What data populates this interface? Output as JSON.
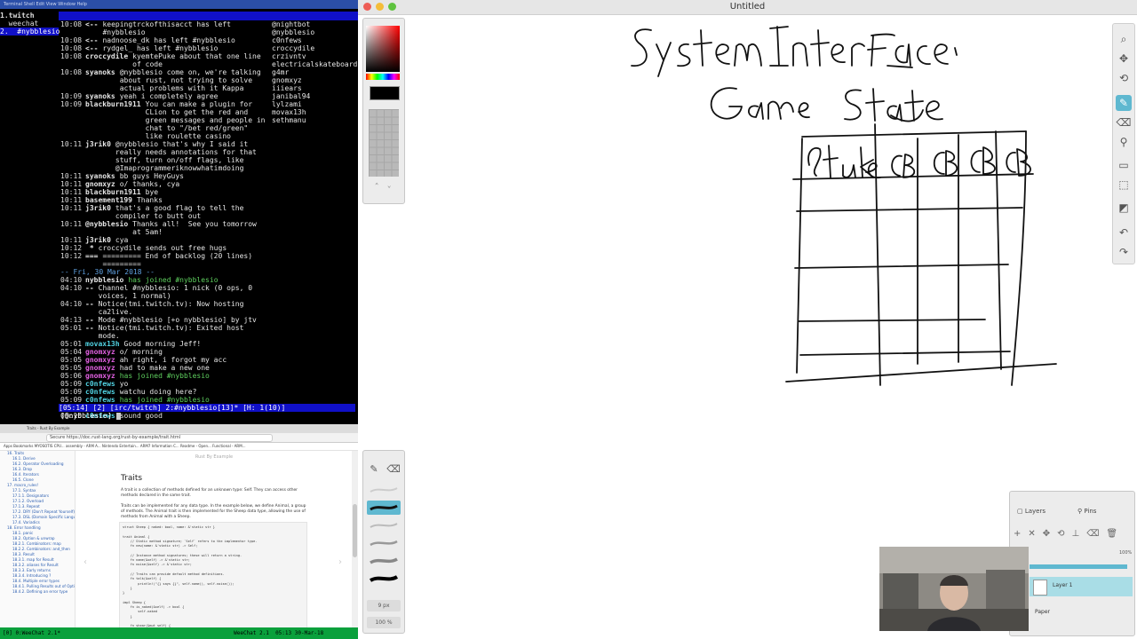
{
  "terminal": {
    "menubar": "Terminal  Shell  Edit  View  Window  Help",
    "buflist": [
      {
        "label": "1.twitch",
        "selected": false,
        "bold": true
      },
      {
        "label": "  weechat",
        "selected": false
      },
      {
        "label": "2.  #nybblesio",
        "selected": true
      }
    ],
    "lines": [
      {
        "time": "10:08",
        "nick": "<--",
        "msg": "keepingtrckofthisacct has left #nybblesio",
        "kind": "part"
      },
      {
        "time": "10:08",
        "nick": "<--",
        "msg": "nadnoose_dk has left #nybblesio",
        "kind": "part"
      },
      {
        "time": "10:08",
        "nick": "<--",
        "msg": "rydgel_ has left #nybblesio",
        "kind": "part"
      },
      {
        "time": "10:08",
        "nick": "croccydile",
        "msg": "kyemtePuke about that one line of code",
        "kind": "msg"
      },
      {
        "time": "10:08",
        "nick": "syanoks",
        "msg": "@nybblesio come on, we're talking about rust, not trying to solve actual problems with it Kappa",
        "kind": "msg"
      },
      {
        "time": "10:09",
        "nick": "syanoks",
        "msg": "yeah i completely agree",
        "kind": "msg"
      },
      {
        "time": "10:09",
        "nick": "blackburn1911",
        "msg": "You can make a plugin for CLion to get the red and green messages and people in chat to \"/bet red/green\" like roulette casino",
        "kind": "msg"
      },
      {
        "time": "10:11",
        "nick": "j3rik0",
        "msg": "@nybblesio that's why I said it really needs annotations for that stuff, turn on/off flags, like @Imaprogrammeriknowwhatimdoing",
        "kind": "msg"
      },
      {
        "time": "10:11",
        "nick": "syanoks",
        "msg": "bb guys HeyGuys",
        "kind": "msg"
      },
      {
        "time": "10:11",
        "nick": "gnomxyz",
        "msg": "o/ thanks, cya",
        "kind": "msg"
      },
      {
        "time": "10:11",
        "nick": "blackburn1911",
        "msg": "bye",
        "kind": "msg"
      },
      {
        "time": "10:11",
        "nick": "basement199",
        "msg": "Thanks",
        "kind": "msg"
      },
      {
        "time": "10:11",
        "nick": "j3rik0",
        "msg": "that's a good flag to tell the compiler to butt out",
        "kind": "msg"
      },
      {
        "time": "10:11",
        "nick": "@nybblesio",
        "msg": "Thanks all!  See you tomorrow at 5am!",
        "kind": "msg"
      },
      {
        "time": "10:11",
        "nick": "j3rik0",
        "msg": "cya",
        "kind": "msg"
      },
      {
        "time": "10:12",
        "nick": " *",
        "msg": "croccydile sends out free hugs",
        "kind": "msg"
      },
      {
        "time": "10:12",
        "nick": "===",
        "msg": "========= End of backlog (20 lines) =========",
        "kind": "msg"
      },
      {
        "time": "",
        "nick": "",
        "msg": "-- Fri, 30 Mar 2018 --",
        "kind": "date"
      },
      {
        "time": "04:10",
        "nick": "nybblesio",
        "msg": "has joined #nybblesio",
        "kind": "join"
      },
      {
        "time": "04:10",
        "nick": "--",
        "msg": "Channel #nybblesio: 1 nick (0 ops, 0 voices, 1 normal)",
        "kind": "msg"
      },
      {
        "time": "04:10",
        "nick": "--",
        "msg": "Notice(tmi.twitch.tv): Now hosting ca2live.",
        "kind": "msg"
      },
      {
        "time": "04:13",
        "nick": "--",
        "msg": "Mode #nybblesio [+o nybblesio] by jtv",
        "kind": "msg"
      },
      {
        "time": "05:01",
        "nick": "--",
        "msg": "Notice(tmi.twitch.tv): Exited host mode.",
        "kind": "msg"
      },
      {
        "time": "05:01",
        "nick": "movax13h",
        "msg": "Good morning Jeff!",
        "kind": "msg",
        "color": "cyan"
      },
      {
        "time": "05:04",
        "nick": "gnomxyz",
        "msg": "o/ morning",
        "kind": "msg",
        "color": "magenta"
      },
      {
        "time": "05:05",
        "nick": "gnomxyz",
        "msg": "ah right, i forgot my acc",
        "kind": "msg",
        "color": "magenta"
      },
      {
        "time": "05:05",
        "nick": "gnomxyz",
        "msg": "had to make a new one",
        "kind": "msg",
        "color": "magenta"
      },
      {
        "time": "05:06",
        "nick": "gnomxyz",
        "msg": "has joined #nybblesio",
        "kind": "join",
        "color": "magenta"
      },
      {
        "time": "05:09",
        "nick": "c0nfews",
        "msg": "yo",
        "kind": "msg",
        "color": "cyan"
      },
      {
        "time": "05:09",
        "nick": "c0nfews",
        "msg": "watchu doing here?",
        "kind": "msg",
        "color": "cyan"
      },
      {
        "time": "05:09",
        "nick": "c0nfews",
        "msg": "has joined #nybblesio",
        "kind": "join",
        "color": "cyan"
      },
      {
        "time": "05:10",
        "nick": "c0nfews",
        "msg": "i don't know what that means but",
        "kind": "msg",
        "color": "cyan"
      },
      {
        "time": "05:10",
        "nick": "c0nfews",
        "msg": "sound good",
        "kind": "msg",
        "color": "cyan"
      }
    ],
    "nicklist": [
      "@nightbot",
      "@nybblesio",
      "c0nfews",
      "croccydile",
      "crzivntv",
      "electricalskateboard",
      "g4mr",
      "gnomxyz",
      "iiiears",
      "janibal94",
      "lylzami",
      "movax13h",
      "sethmanu"
    ],
    "statusbar": "[05:14] [2] [irc/twitch] 2:#nybblesio[13]* [H: 1(10)]",
    "input_prompt": "[@nybblesio]",
    "bottombar_left": "[0] 0:WeeChat 2.1*",
    "bottombar_right": "WeeChat 2.1  05:13 30-Mar-18"
  },
  "browser": {
    "tabs": "Traits - Rust By Example",
    "address": "Secure  https://doc.rust-lang.org/rust-by-example/trait.html",
    "bookmarks": "Apps  Bookmarks  MYOSOTIS CPU...  assembly - ARM A...  Nintendo Entertain...  ARM7 Information C...  Readme - Open...  Functional - ARM...",
    "sidebar": [
      {
        "label": "16. Traits",
        "sub": false
      },
      {
        "label": "16.1. Derive",
        "sub": true
      },
      {
        "label": "16.2. Operator Overloading",
        "sub": true
      },
      {
        "label": "16.3. Drop",
        "sub": true
      },
      {
        "label": "16.4. Iterators",
        "sub": true
      },
      {
        "label": "16.5. Clone",
        "sub": true
      },
      {
        "label": "17. macro_rules!",
        "sub": false
      },
      {
        "label": "17.1. Syntax",
        "sub": true
      },
      {
        "label": "17.1.1. Designators",
        "sub": true
      },
      {
        "label": "17.1.2. Overload",
        "sub": true
      },
      {
        "label": "17.1.3. Repeat",
        "sub": true
      },
      {
        "label": "17.2. DRY (Don't Repeat Yourself)",
        "sub": true
      },
      {
        "label": "17.3. DSL (Domain Specific Languages)",
        "sub": true
      },
      {
        "label": "17.4. Variadics",
        "sub": true
      },
      {
        "label": "18. Error handling",
        "sub": false
      },
      {
        "label": "18.1. panic",
        "sub": true
      },
      {
        "label": "18.2. Option & unwrap",
        "sub": true
      },
      {
        "label": "18.2.1. Combinators: map",
        "sub": true
      },
      {
        "label": "18.2.2. Combinators: and_then",
        "sub": true
      },
      {
        "label": "18.3. Result",
        "sub": true
      },
      {
        "label": "18.3.1. map for Result",
        "sub": true
      },
      {
        "label": "18.3.2. aliases for Result",
        "sub": true
      },
      {
        "label": "18.3.3. Early returns",
        "sub": true
      },
      {
        "label": "18.3.4. Introducing ?",
        "sub": true
      },
      {
        "label": "18.4. Multiple error types",
        "sub": true
      },
      {
        "label": "18.4.1. Pulling Results out of Options",
        "sub": true
      },
      {
        "label": "18.4.2. Defining an error type",
        "sub": true
      }
    ],
    "site_title": "Rust By Example",
    "heading": "Traits",
    "para1": "A trait is a collection of methods defined for an unknown type: Self. They can access other methods declared in the same trait.",
    "para2": "Traits can be implemented for any data type. In the example below, we define Animal, a group of methods. The Animal trait is then implemented for the Sheep data type, allowing the use of methods from Animal with a Sheep.",
    "code": "struct Sheep { naked: bool, name: &'static str }\n\ntrait Animal {\n    // Static method signature; `Self` refers to the implementor type.\n    fn new(name: &'static str) -> Self;\n\n    // Instance method signatures; these will return a string.\n    fn name(&self) -> &'static str;\n    fn noise(&self) -> &'static str;\n\n    // Traits can provide default method definitions.\n    fn talk(&self) {\n        println!(\"{} says {}\", self.name(), self.noise());\n    }\n}\n\nimpl Sheep {\n    fn is_naked(&self) -> bool {\n        self.naked\n    }\n\n    fn shear(&mut self) {\n        if self.is_naked() {\n            // Implementor methods can use the implementor's trait methods.\n            println!(\"{} is already naked...\", self.name());\n        } else {\n            println!(\"{} gets a haircut!\", self.name);"
  },
  "app": {
    "window_title": "Untitled",
    "brush_size": "9 px",
    "brush_opacity": "100 %",
    "layers_tab": "Layers",
    "pins_tab": "Pins",
    "opacity": "100%",
    "layer_name": "Layer 1",
    "paper_label": "Paper"
  },
  "colors": {
    "terminal_bg": "#000000",
    "weechat_blue": "#1010c8",
    "accent": "#5fb8d0",
    "status_green": "#0aa03c"
  }
}
